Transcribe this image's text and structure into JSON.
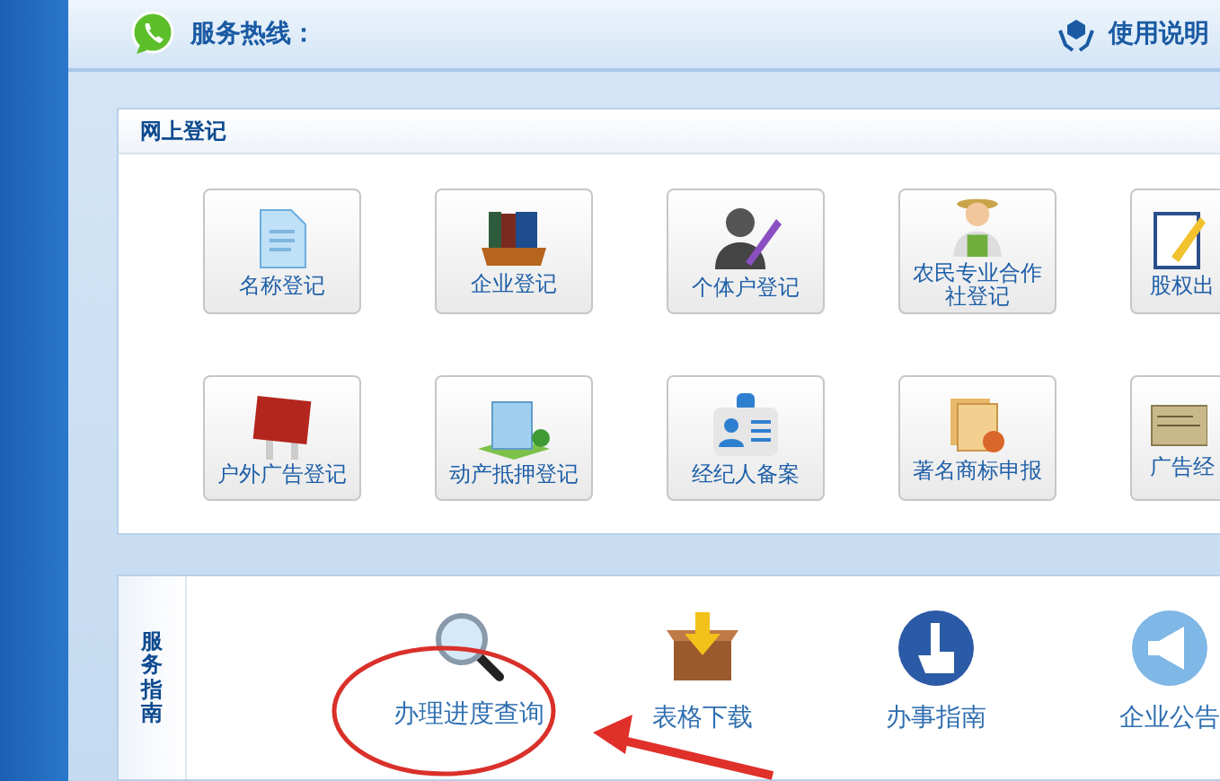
{
  "header": {
    "hotline_label": "服务热线：",
    "help_link": "使用说明"
  },
  "online_registration": {
    "title": "网上登记",
    "tiles": [
      {
        "label": "名称登记",
        "kind": "full"
      },
      {
        "label": "企业登记",
        "kind": "full"
      },
      {
        "label": "个体户登记",
        "kind": "full"
      },
      {
        "label": "农民专业合作社登记",
        "kind": "full"
      },
      {
        "label": "股权出",
        "kind": "partial"
      },
      {
        "label": "户外广告登记",
        "kind": "full"
      },
      {
        "label": "动产抵押登记",
        "kind": "full"
      },
      {
        "label": "经纪人备案",
        "kind": "full"
      },
      {
        "label": "著名商标申报",
        "kind": "full"
      },
      {
        "label": "广告经",
        "kind": "partial"
      }
    ]
  },
  "service_guide": {
    "title": "服务指南",
    "items": [
      {
        "label": "办理进度查询"
      },
      {
        "label": "表格下载"
      },
      {
        "label": "办事指南"
      },
      {
        "label": "企业公告"
      }
    ]
  }
}
